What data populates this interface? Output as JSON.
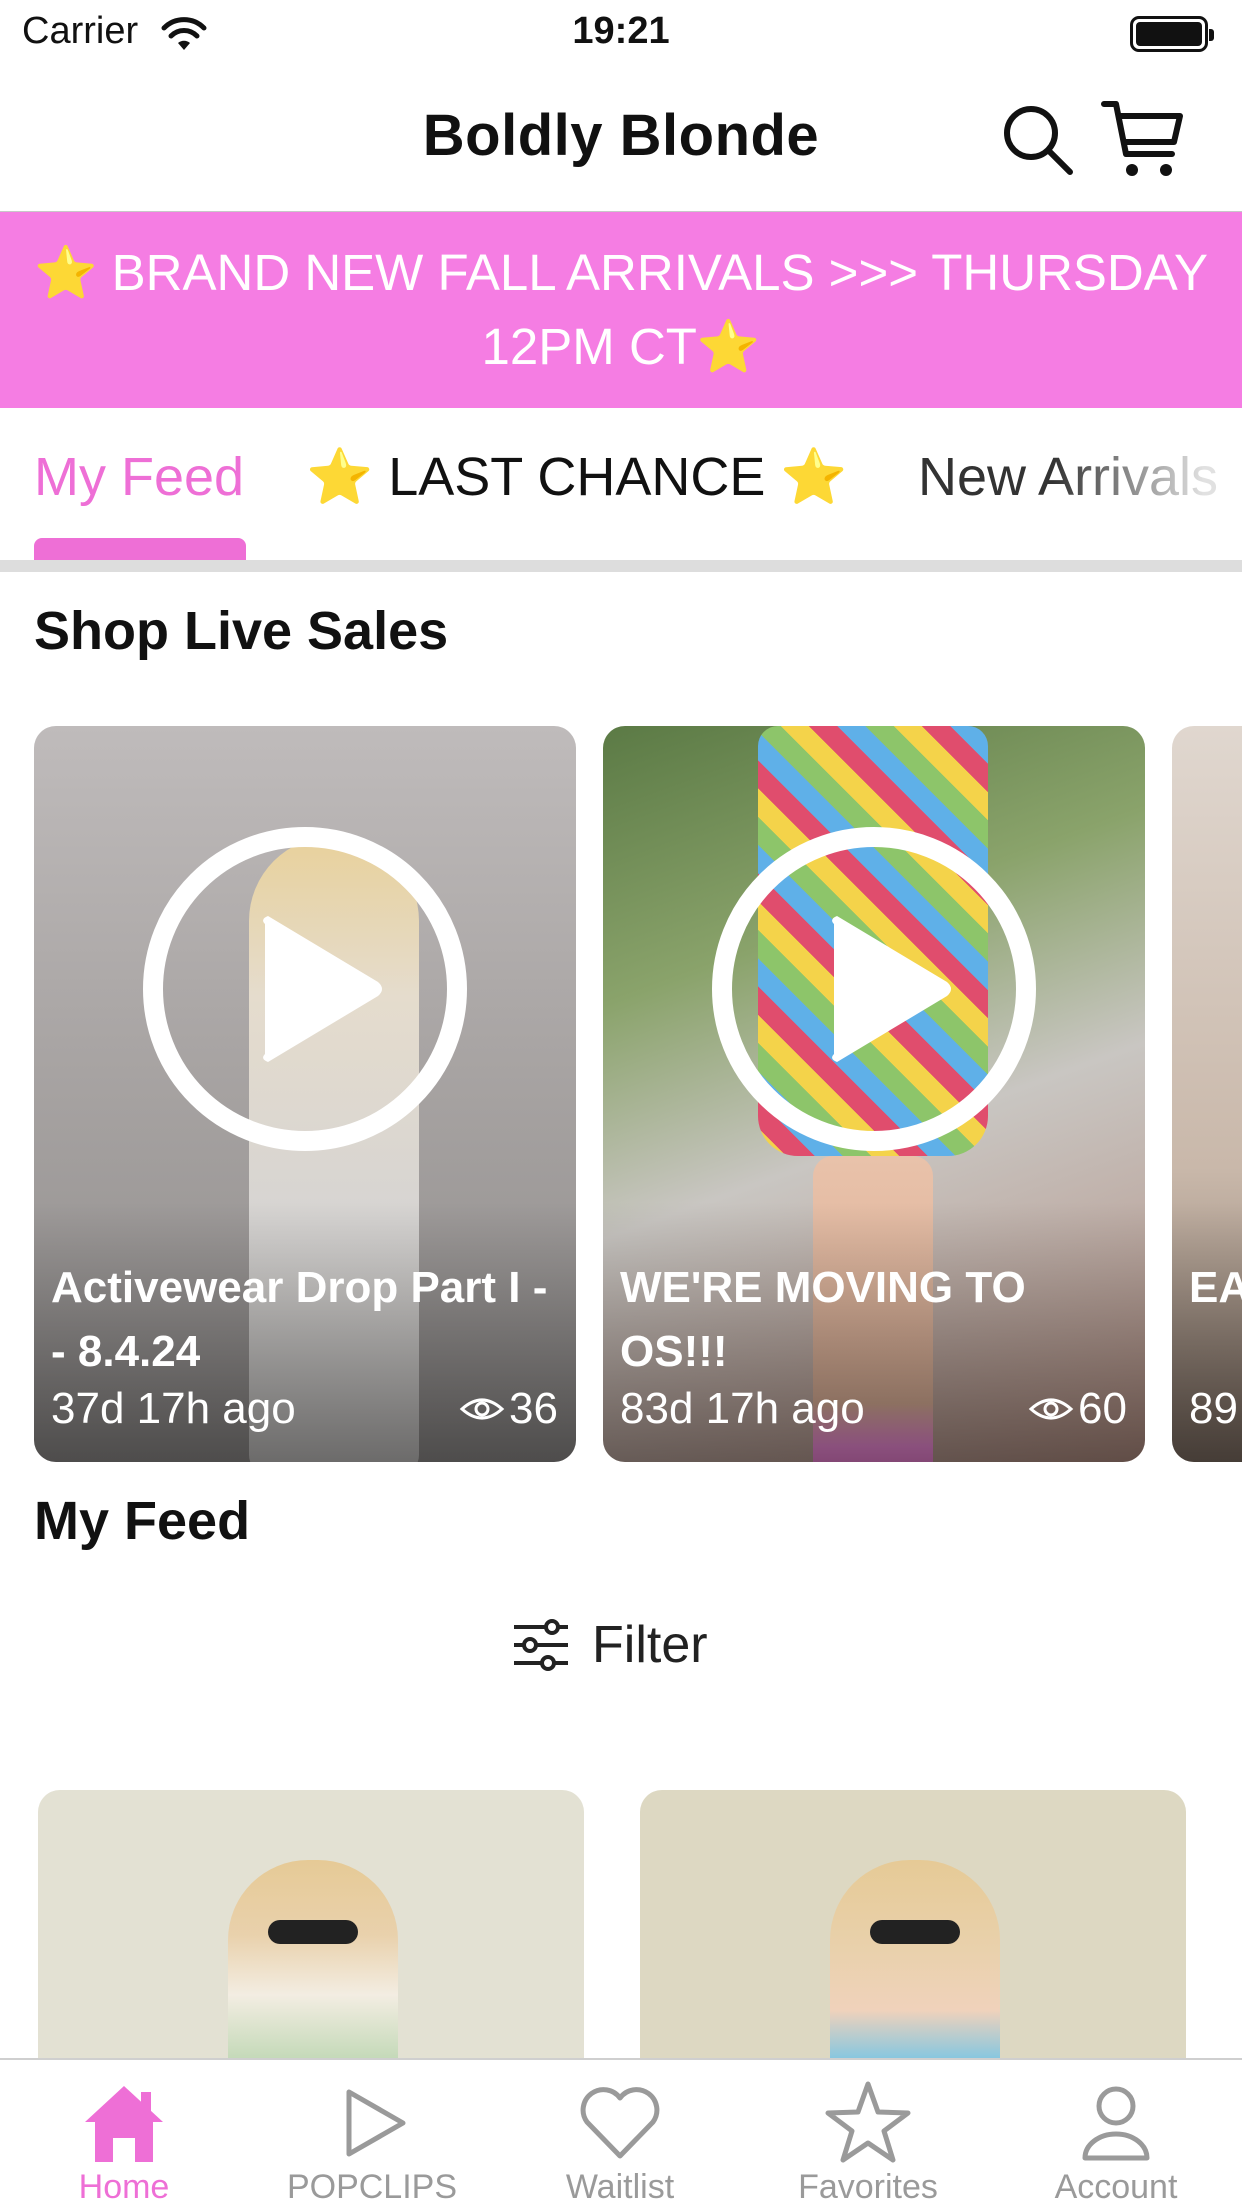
{
  "status_bar": {
    "carrier": "Carrier",
    "time": "19:21"
  },
  "header": {
    "title": "Boldly Blonde"
  },
  "banner": {
    "line1": "⭐ BRAND NEW FALL ARRIVALS >>> THURSDAY",
    "line2": "12PM CT⭐"
  },
  "tabs": [
    {
      "label": "My Feed",
      "active": true
    },
    {
      "label": "⭐ LAST CHANCE ⭐",
      "active": false
    },
    {
      "label": "New Arrivals",
      "active": false
    }
  ],
  "sections": {
    "live_title": "Shop Live Sales",
    "feed_title": "My Feed"
  },
  "live_sales": [
    {
      "title": "Activewear Drop Part I -- 8.4.24",
      "time": "37d 17h ago",
      "views": "36"
    },
    {
      "title": "WE'RE MOVING TO OS!!!",
      "time": "83d 17h ago",
      "views": "60"
    },
    {
      "title": "EA SA",
      "time": "89"
    }
  ],
  "filter": {
    "label": "Filter"
  },
  "bottom_nav": [
    {
      "label": "Home",
      "icon": "home-icon",
      "active": true
    },
    {
      "label": "POPCLIPS",
      "icon": "play-icon",
      "active": false
    },
    {
      "label": "Waitlist",
      "icon": "heart-icon",
      "active": false
    },
    {
      "label": "Favorites",
      "icon": "star-icon",
      "active": false
    },
    {
      "label": "Account",
      "icon": "person-icon",
      "active": false
    }
  ],
  "colors": {
    "accent": "#ee6fd6",
    "banner_bg": "#f57de3",
    "inactive": "#9a9a9a"
  }
}
